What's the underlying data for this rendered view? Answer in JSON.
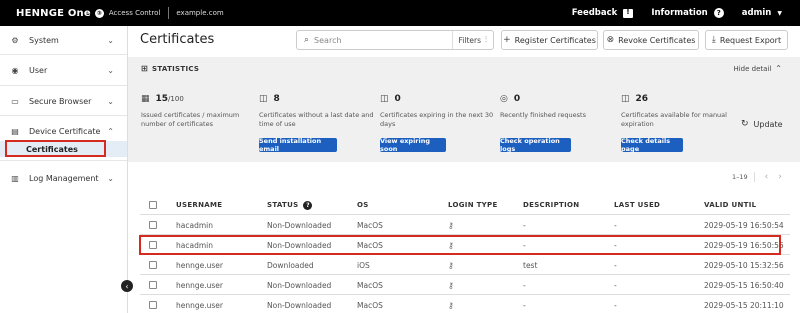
{
  "topbar": {
    "brand": "HENNGE One",
    "logo_glyph": "③",
    "product": "Access Control",
    "domain": "example.com",
    "feedback": "Feedback",
    "information": "Information",
    "user": "admin"
  },
  "sidebar": {
    "items": [
      {
        "label": "System",
        "icon": "gear-icon"
      },
      {
        "label": "User",
        "icon": "user-icon"
      },
      {
        "label": "Secure Browser",
        "icon": "browser-icon"
      },
      {
        "label": "Device Certificate",
        "icon": "certificate-icon"
      },
      {
        "label": "Log Management",
        "icon": "chart-icon"
      }
    ],
    "sub_item": "Certificates"
  },
  "main": {
    "title": "Certificates",
    "search_placeholder": "Search",
    "filters_label": "Filters",
    "buttons": {
      "register": "Register Certificates",
      "revoke": "Revoke Certificates",
      "export": "Request Export"
    }
  },
  "stats": {
    "title": "STATISTICS",
    "hide_detail": "Hide detail",
    "update": "Update",
    "items": [
      {
        "value": "15",
        "max": "/100",
        "desc": "Issued certificates / maximum number of certificates",
        "button": ""
      },
      {
        "value": "8",
        "max": "",
        "desc": "Certificates without a last date and time of use",
        "button": "Send installation email"
      },
      {
        "value": "0",
        "max": "",
        "desc": "Certificates expiring in the next 30 days",
        "button": "View expiring soon"
      },
      {
        "value": "0",
        "max": "",
        "desc": "Recently finished requests",
        "button": "Check operation logs"
      },
      {
        "value": "26",
        "max": "",
        "desc": "Certificates available for manual expiration",
        "button": "Check details page"
      }
    ]
  },
  "pager": {
    "range": "1–19"
  },
  "table": {
    "headers": {
      "username": "USERNAME",
      "status": "STATUS",
      "os": "OS",
      "login_type": "LOGIN TYPE",
      "description": "DESCRIPTION",
      "last_used": "LAST USED",
      "valid_until": "VALID UNTIL"
    },
    "rows": [
      {
        "username": "hacadmin",
        "status": "Non-Downloaded",
        "os": "MacOS",
        "description": "-",
        "last_used": "-",
        "valid_until": "2029-05-19 16:50:54"
      },
      {
        "username": "hacadmin",
        "status": "Non-Downloaded",
        "os": "MacOS",
        "description": "-",
        "last_used": "-",
        "valid_until": "2029-05-19 16:50:56"
      },
      {
        "username": "hennge.user",
        "status": "Downloaded",
        "os": "iOS",
        "description": "test",
        "last_used": "-",
        "valid_until": "2029-05-10 15:32:56"
      },
      {
        "username": "hennge.user",
        "status": "Non-Downloaded",
        "os": "MacOS",
        "description": "-",
        "last_used": "-",
        "valid_until": "2029-05-15 16:50:40"
      },
      {
        "username": "hennge.user",
        "status": "Non-Downloaded",
        "os": "MacOS",
        "description": "-",
        "last_used": "-",
        "valid_until": "2029-05-15 20:11:10"
      }
    ]
  }
}
